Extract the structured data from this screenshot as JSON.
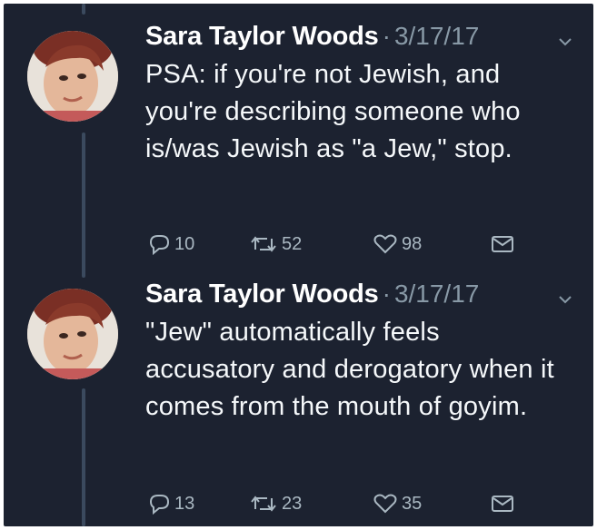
{
  "tweets": [
    {
      "author": "Sara Taylor Woods",
      "separator": "·",
      "date": "3/17/17",
      "text": "PSA: if you're not Jewish, and you're describing someone who is/was Jewish as \"a Jew,\" stop.",
      "replies": "10",
      "retweets": "52",
      "likes": "98"
    },
    {
      "author": "Sara Taylor Woods",
      "separator": "·",
      "date": "3/17/17",
      "text": "\"Jew\" automatically feels accusatory and derogatory when it comes from the mouth of goyim.",
      "replies": "13",
      "retweets": "23",
      "likes": "35"
    }
  ],
  "colors": {
    "background": "#1c2230",
    "text": "#f5f8fa",
    "muted": "#8899a6",
    "thread_line": "#3b4a5e"
  },
  "icons": [
    "reply-icon",
    "retweet-icon",
    "like-icon",
    "dm-icon",
    "chevron-down-icon"
  ]
}
